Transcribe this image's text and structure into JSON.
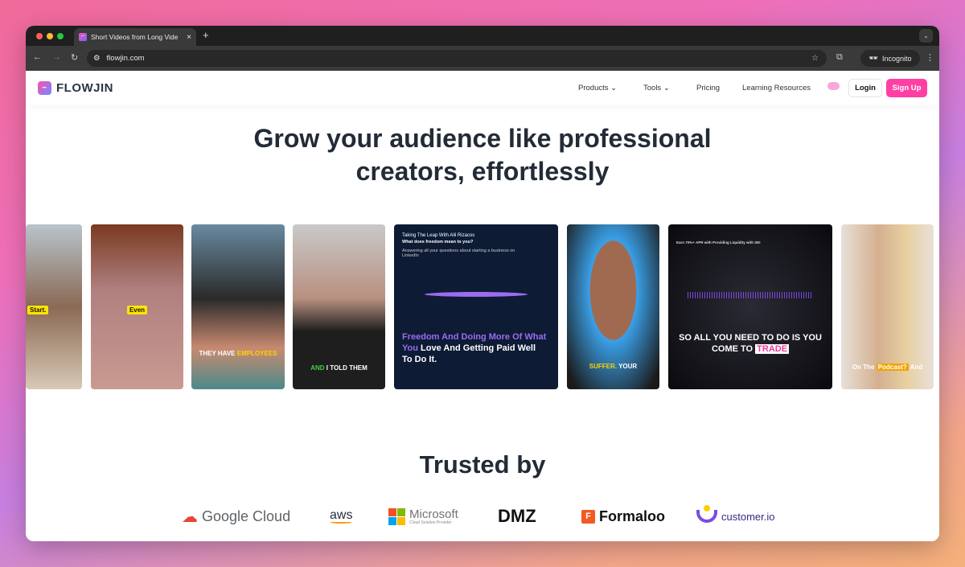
{
  "browser": {
    "tab_title": "Short Videos from Long Vide",
    "url": "flowjin.com",
    "incognito_label": "Incognito"
  },
  "header": {
    "logo": "FLOWJIN",
    "nav": [
      "Products",
      "Tools",
      "Pricing",
      "Learning Resources"
    ],
    "login": "Login",
    "signup": "Sign Up"
  },
  "hero": {
    "title_line1": "Grow your audience like professional",
    "title_line2": "creators, effortlessly"
  },
  "videos": [
    {
      "caption": "Start."
    },
    {
      "caption": "Even"
    },
    {
      "caption_a": "THEY HAVE ",
      "caption_b": "EMPLOYEES"
    },
    {
      "caption_a": "AND",
      "caption_b": " I TOLD THEM"
    },
    {
      "title": "Taking The Leap With Alli Rizacos",
      "subtitle": "What does freedom mean to you?",
      "desc": "Answering all your questions about starting a business on LinkedIn",
      "quote_a": "Freedom And Doing More Of What You",
      "quote_b": " Love And Getting Paid Well To Do It."
    },
    {
      "caption_a": "SUFFER.",
      "caption_b": " YOUR"
    },
    {
      "top": "Earn 70%+ APR with Providing Liquidity with SEI",
      "caption_a": "SO ALL YOU NEED TO DO IS YOU COME TO ",
      "caption_b": "TRADE"
    },
    {
      "caption_a": "On The ",
      "caption_b": "Podcast?",
      "caption_c": " And"
    }
  ],
  "trusted": {
    "title": "Trusted by",
    "logos": [
      "Google Cloud",
      "aws",
      "Microsoft",
      "Cloud Solution Provider",
      "DMZ",
      "Formaloo",
      "customer.io"
    ]
  },
  "colors": {
    "accent": "#ff3fa4",
    "heading": "#232b37",
    "video_purple": "#9b6cf0"
  }
}
